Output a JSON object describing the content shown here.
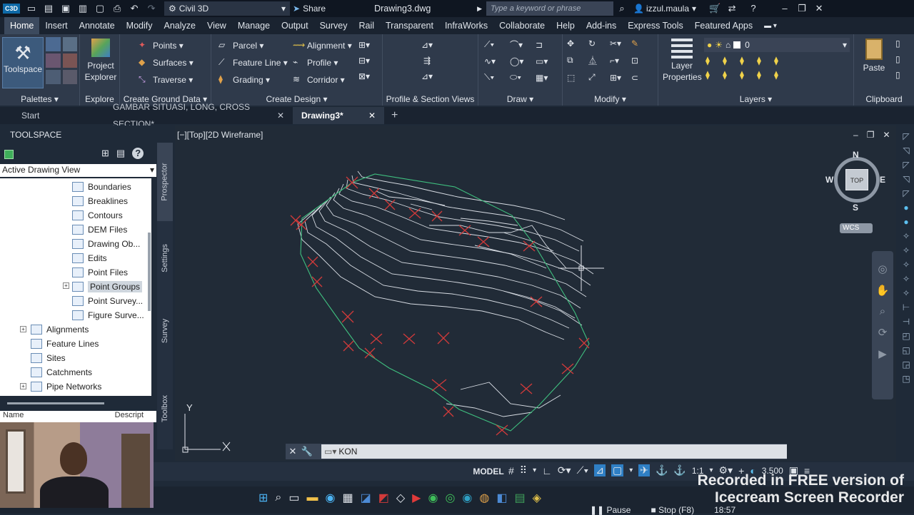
{
  "titlebar": {
    "logo": "C3D",
    "workspace": "Civil 3D",
    "share": "Share",
    "filename": "Drawing3.dwg",
    "search_placeholder": "Type a keyword or phrase",
    "user": "izzul.maula"
  },
  "menu": [
    "Home",
    "Insert",
    "Annotate",
    "Modify",
    "Analyze",
    "View",
    "Manage",
    "Output",
    "Survey",
    "Rail",
    "Transparent",
    "InfraWorks",
    "Collaborate",
    "Help",
    "Add-ins",
    "Express Tools",
    "Featured Apps"
  ],
  "ribbon": {
    "toolspace": "Toolspace",
    "project_explorer": "Project Explorer",
    "palettes": "Palettes",
    "explore": "Explore",
    "points": "Points",
    "surfaces": "Surfaces",
    "traverse": "Traverse",
    "create_ground": "Create Ground Data",
    "parcel": "Parcel",
    "feature_line": "Feature Line",
    "grading": "Grading",
    "alignment": "Alignment",
    "profile": "Profile",
    "corridor": "Corridor",
    "create_design": "Create Design",
    "profile_section": "Profile & Section Views",
    "draw": "Draw",
    "modify": "Modify",
    "layer_props": "Layer Properties",
    "layer_value": "0",
    "layers": "Layers",
    "paste": "Paste",
    "clipboard": "Clipboard"
  },
  "doctabs": {
    "start": "Start",
    "tab1": "GAMBAR SITUASI, LONG, CROSS SECTION*",
    "tab2": "Drawing3*"
  },
  "toolspace": {
    "title": "TOOLSPACE",
    "view": "Active Drawing View",
    "items": [
      "Boundaries",
      "Breaklines",
      "Contours",
      "DEM Files",
      "Drawing Ob...",
      "Edits",
      "Point Files",
      "Point Groups",
      "Point Survey...",
      "Figure Surve...",
      "Alignments",
      "Feature Lines",
      "Sites",
      "Catchments",
      "Pipe Networks"
    ],
    "col_name": "Name",
    "col_desc": "Descript"
  },
  "vtabs": [
    "Prospector",
    "Settings",
    "Survey",
    "Toolbox"
  ],
  "viewport": {
    "label": "[−][Top][2D Wireframe]",
    "top": "TOP",
    "n": "N",
    "s": "S",
    "e": "E",
    "w": "W",
    "wcs": "WCS",
    "y": "Y"
  },
  "command": {
    "value": "KON"
  },
  "status": {
    "model": "MODEL",
    "scale": "1:1",
    "value": "3.500"
  },
  "taskbar": {
    "pause": "Pause",
    "stop": "Stop (F8)",
    "time": "18:57"
  },
  "watermark": "Recorded in FREE version of Icecream Screen Recorder",
  "colors": {
    "accent": "#0696d7",
    "contour": "#d8dde4",
    "boundary": "#3fbf7f",
    "marker": "#d23a3a"
  }
}
